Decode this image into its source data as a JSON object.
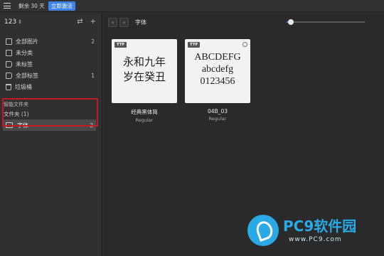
{
  "topbar": {
    "trial_text": "剩余 30 天",
    "activate_label": "立即激活"
  },
  "sidebar": {
    "library_name": "123",
    "items": [
      {
        "label": "全部图片",
        "count": "2"
      },
      {
        "label": "未分类",
        "count": ""
      },
      {
        "label": "未标签",
        "count": ""
      },
      {
        "label": "全部标签",
        "count": "1"
      },
      {
        "label": "垃圾桶",
        "count": ""
      }
    ],
    "smart_folders_title": "智能文件夹",
    "folders_header": "文件夹 (1)",
    "folder": {
      "label": "字体",
      "count": "2"
    }
  },
  "toolbar": {
    "path_label": "字体",
    "zoom_fraction": 0.05
  },
  "cards": [
    {
      "badge": "TTF",
      "preview_lines": [
        "永和九年",
        "岁在癸丑"
      ],
      "name": "经典黑体简",
      "style": "Regular",
      "selected": false
    },
    {
      "badge": "TTF",
      "preview_lines": [
        "ABCDEFG",
        "abcdefg",
        "0123456"
      ],
      "name": "04B_03",
      "style": "Regular",
      "selected": true
    }
  ],
  "watermark": {
    "brand": "PC9软件园",
    "url": "www.PC9.com"
  },
  "colors": {
    "accent": "#3d83e8",
    "highlight": "#c2181f",
    "watermark": "#29a9e6"
  }
}
